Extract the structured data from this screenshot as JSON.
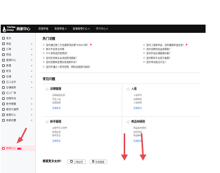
{
  "topbar": {
    "logo_text": "TikTok Shop",
    "brand": "商家中心",
    "nav": [
      {
        "label": "数据罗盘",
        "has_menu": false
      },
      {
        "label": "数据罗盘",
        "has_menu": true
      },
      {
        "label": "直播管理中心",
        "has_menu": true
      },
      {
        "label": "学习中心",
        "has_menu": true
      }
    ]
  },
  "sidebar": {
    "items": [
      {
        "label": "首页",
        "has_arrow": false
      },
      {
        "label": "商品",
        "has_arrow": true
      },
      {
        "label": "订单",
        "has_arrow": true
      },
      {
        "label": "物流",
        "has_arrow": true
      },
      {
        "label": "营销中心",
        "has_arrow": true
      },
      {
        "label": "数据",
        "has_arrow": true
      },
      {
        "label": "财务",
        "has_arrow": true
      },
      {
        "label": "店铺",
        "has_arrow": true
      },
      {
        "label": "达人合作",
        "has_arrow": true
      },
      {
        "label": "店铺装修",
        "has_arrow": true
      },
      {
        "label": "达人广场",
        "has_arrow": false
      },
      {
        "label": "违规申诉",
        "has_arrow": true
      },
      {
        "label": "账号健康",
        "has_arrow": true
      },
      {
        "label": "服务与保障",
        "has_arrow": true
      },
      {
        "label": "客服中心",
        "has_arrow": true
      },
      {
        "label": "商家设置",
        "has_arrow": true
      }
    ],
    "active_item": {
      "label": "帮助中心"
    }
  },
  "hot": {
    "title": "热门话题",
    "left": [
      "如何通过第三方自建物流处理TikTok订单？",
      "新手开店常见问题",
      "什么是商品的违禁品？",
      "如何在商家后台添加物流模板？",
      "如何查看和处理买家退款申请？",
      "如何开通达人带货权限，帮助店铺提升销量？"
    ],
    "right": [
      "如何上架新商品，如何编辑商品信息？",
      "如何设置商品运费模板？",
      "如何开启店铺直播功能？",
      "如何联系平台官方客服？",
      "如何申请退出平台？"
    ]
  },
  "faq": {
    "title": "常见问题",
    "cards": [
      {
        "title": "店铺管理",
        "items": [
          "店铺基础设置",
          "开店入驻",
          "店铺违规"
        ],
        "more": "查看更多"
      },
      {
        "title": "入驻",
        "items": [
          "入驻条件",
          "资质审核",
          "入驻费用"
        ],
        "more": "查看更多"
      },
      {
        "title": "账号管理",
        "items": [
          "主账号与子账号",
          "权限设置",
          "账号安全"
        ],
        "more": "查看更多"
      },
      {
        "title": "商品和规则",
        "items": [
          "商品发布规则",
          "禁售商品",
          "商品审核"
        ],
        "more": "查看更多"
      }
    ]
  },
  "help": {
    "question": "需要更多支持？",
    "btn_ticket": "工单反馈",
    "btn_chat": "在线客服"
  },
  "colors": {
    "topbar": "#111111",
    "accent": "#fe2c55",
    "arrow": "#e5484d"
  }
}
